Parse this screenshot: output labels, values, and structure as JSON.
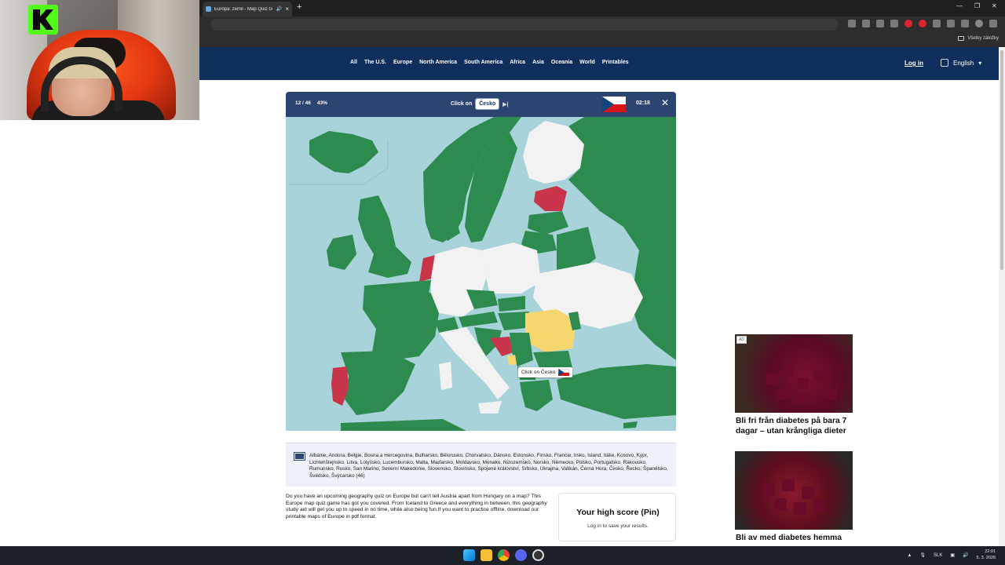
{
  "browser": {
    "tab_title": "Európa: zemil - Map Quiz G",
    "bookmarks_all": "Všetky záložky"
  },
  "site": {
    "nav": [
      "All",
      "The U.S.",
      "Europe",
      "North America",
      "South America",
      "Africa",
      "Asia",
      "Oceania",
      "World",
      "Printables"
    ],
    "login": "Log in",
    "language": "English"
  },
  "quiz": {
    "progress": "12 / 46",
    "percent": "43%",
    "prompt_prefix": "Click on",
    "prompt_country": "Česko",
    "timer": "02:18",
    "tooltip": "Click on Česko"
  },
  "country_list": "Albánie, Andora, Belgie, Bosna a Hercegovina, Bulharsko, Bělorusko, Chorvatsko, Dánsko, Estonsko, Finsko, Francie, Irsko, Island, Itálie, Kosovo, Kypr, Lichtenštejnsko, Litva, Lotyšsko, Lucembursko, Malta, Maďarsko, Moldavsko, Monako, Nizozemsko, Norsko, Německo, Polsko, Portugalsko, Rakousko, Rumunsko, Rusko, San Marino, Severní Makedonie, Slovensko, Slovinsko, Spojené království, Srbsko, Ukrajina, Vatikán, Černá Hora, Česko, Řecko, Španělsko, Švédsko, Švýcarsko (46)",
  "description": "Do you have an upcoming geography quiz on Europe but can't tell Austria apart from Hungary on a map? This Europe map quiz game has got you covered. From Iceland to Greece and everything in between, this geography study aid will get you up to speed in no time, while also being fun.If you want to practice offline, download our printable maps of Europe in pdf format.",
  "highscore": {
    "title": "Your high score (Pin)",
    "subtitle": "Log in to save your results."
  },
  "ads": {
    "badge": "AD",
    "ad1_caption": "Bli fri från diabetes på bara 7 dagar – utan krångliga dieter",
    "ad2_caption": "Bli av med diabetes hemma"
  },
  "taskbar": {
    "lang": "SLK",
    "time": "22:01",
    "date": "5. 3. 2026"
  },
  "colors": {
    "nav_bg": "#0e2e5c",
    "quiz_bar": "#2c4470",
    "correct": "#2e8b4f",
    "wrong": "#c8354a",
    "unanswered": "#f2f2f2",
    "highlight": "#f5d76e",
    "sea": "#a9d3da"
  }
}
